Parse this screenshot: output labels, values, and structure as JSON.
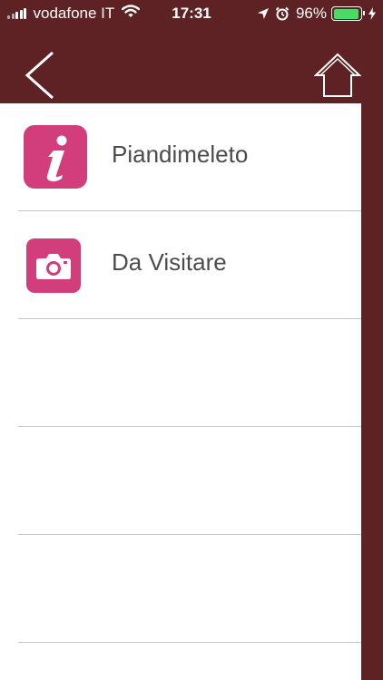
{
  "status_bar": {
    "carrier": "vodafone IT",
    "time": "17:31",
    "battery_percent": "96%",
    "battery_level": 0.96,
    "icons": [
      "signal-icon",
      "wifi-icon",
      "location-arrow-icon",
      "alarm-icon",
      "battery-icon",
      "charging-bolt-icon"
    ]
  },
  "nav_bar": {
    "back_icon": "chevron-left-icon",
    "home_icon": "home-icon"
  },
  "list": {
    "items": [
      {
        "label": "Piandimeleto",
        "icon": "info-icon"
      },
      {
        "label": "Da Visitare",
        "icon": "camera-icon"
      }
    ]
  },
  "colors": {
    "header_background": "#5e2224",
    "icon_background": "#d23d7b",
    "battery_fill": "#4cd964",
    "label_text": "#4c4c4c",
    "divider": "#c5c5c5"
  }
}
